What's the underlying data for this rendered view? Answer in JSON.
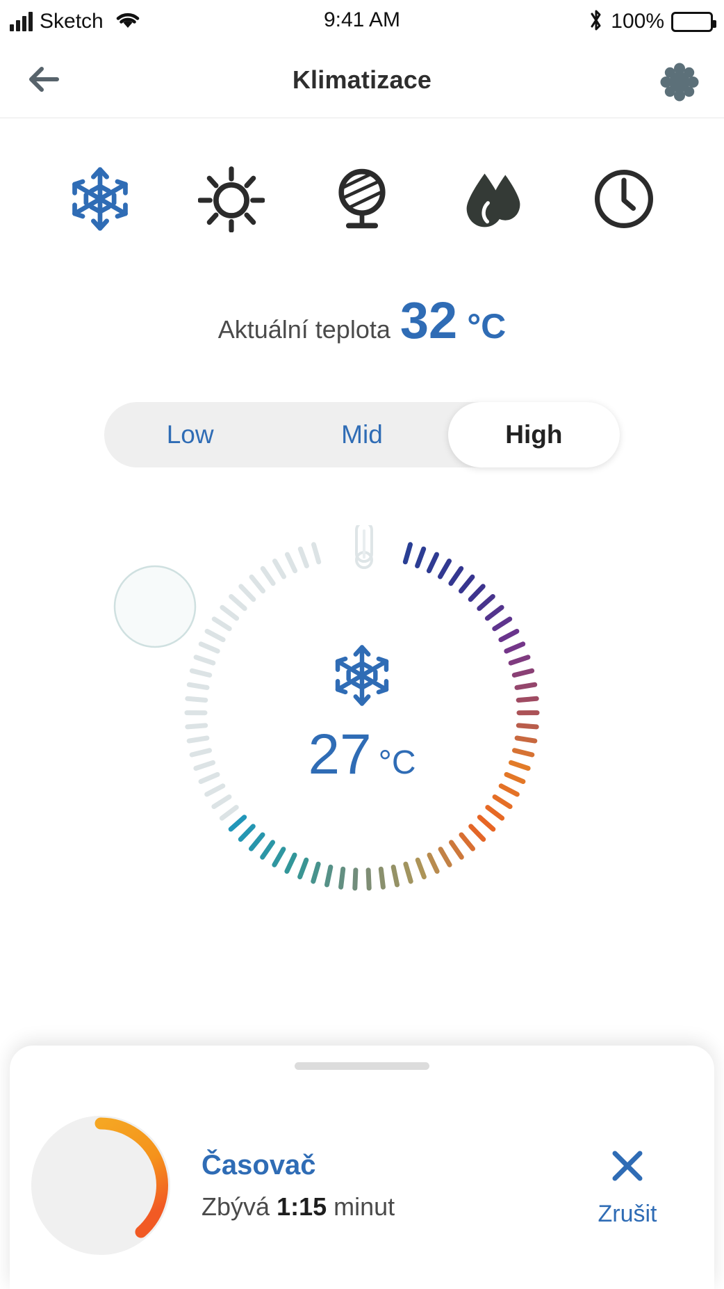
{
  "status_bar": {
    "carrier": "Sketch",
    "time": "9:41 AM",
    "battery_percent": "100%",
    "signal_icon": "signal-bars-icon",
    "wifi_icon": "wifi-icon",
    "bluetooth_icon": "bluetooth-icon",
    "battery_icon": "battery-full-icon"
  },
  "nav": {
    "title": "Klimatizace",
    "back_icon": "arrow-left-icon",
    "settings_icon": "gear-icon"
  },
  "modes": [
    {
      "id": "cool",
      "icon": "snowflake-icon",
      "active": true,
      "color": "#2F6CB5"
    },
    {
      "id": "heat",
      "icon": "sun-icon",
      "active": false,
      "color": "#2b2b2b"
    },
    {
      "id": "fan",
      "icon": "fan-icon",
      "active": false,
      "color": "#2b2b2b"
    },
    {
      "id": "humidity",
      "icon": "droplet-icon",
      "active": false,
      "color": "#343a36"
    },
    {
      "id": "timer",
      "icon": "clock-icon",
      "active": false,
      "color": "#2b2b2b"
    }
  ],
  "current_temperature": {
    "label": "Aktuální teplota",
    "value": "32",
    "unit": "°C"
  },
  "fan_speed": {
    "options": [
      "Low",
      "Mid",
      "High"
    ],
    "selected": "High",
    "selected_index": 2
  },
  "dial": {
    "target_value": "27",
    "target_unit": "°C",
    "center_icon": "snowflake-icon",
    "top_icon": "thermometer-icon",
    "knob_icon": "dial-knob-handle",
    "total_ticks": 72,
    "active_start_tick": 26,
    "gap_top_degrees": 16,
    "accent_color": "#2F6CB5"
  },
  "timer_card": {
    "handle_icon": "drag-handle",
    "title": "Časovač",
    "remaining_prefix": "Zbývá",
    "remaining_value": "1:15",
    "remaining_suffix": "minut",
    "progress_percent": 38,
    "progress_color_start": "#F5A623",
    "progress_color_end": "#F15A24",
    "cancel_icon": "close-x-icon",
    "cancel_label": "Zrušit",
    "cancel_color": "#2F6CB5"
  }
}
